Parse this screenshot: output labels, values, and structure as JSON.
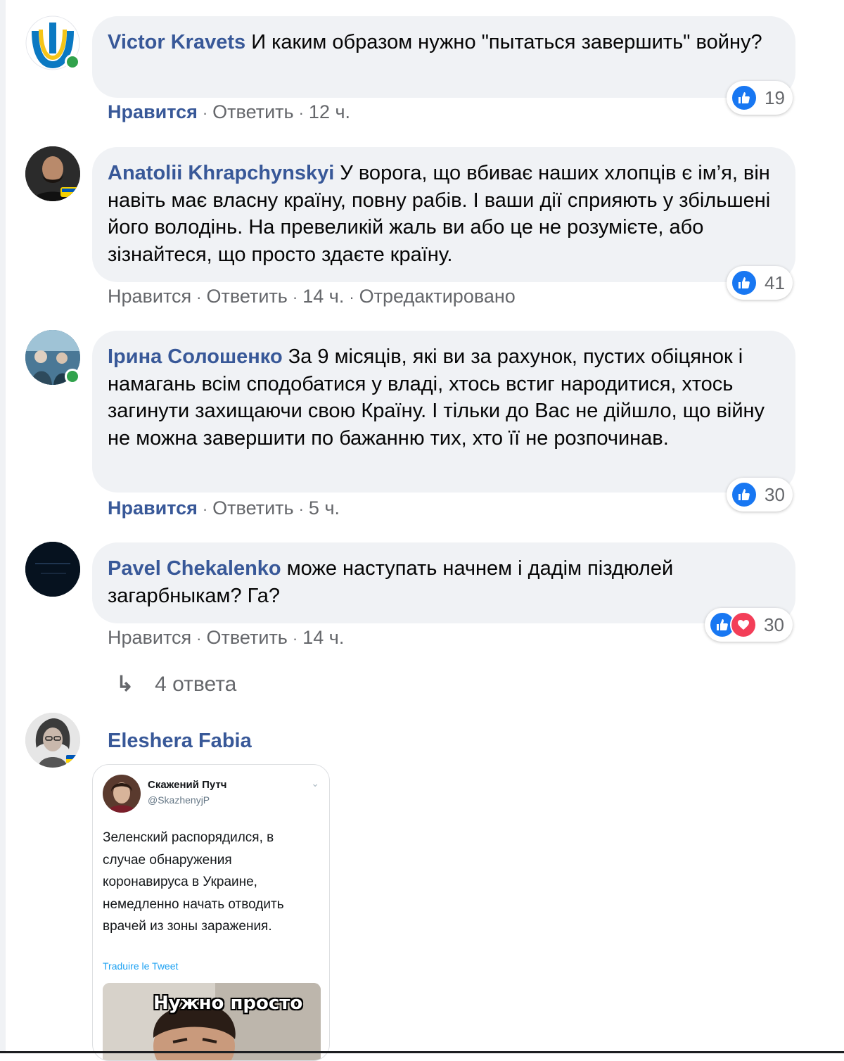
{
  "comments": [
    {
      "author": "Victor Kravets",
      "text": "И каким образом нужно \"пытаться завершить\" войну?",
      "like_label": "Нравится",
      "reply_label": "Ответить",
      "time": "12 ч.",
      "reaction_count": "19",
      "liked": true,
      "online": true
    },
    {
      "author": "Anatolii Khrapchynskyi",
      "text": "У ворога, що вбиває наших хлопців є ім’я, він навіть має власну країну, повну рабів. І ваши дії сприяють у збільшені його володінь. На превеликій жаль ви або це не розумієте, або зізнайтеся, що просто здаєте країну.",
      "like_label": "Нравится",
      "reply_label": "Ответить",
      "time": "14 ч.",
      "edited_label": "Отредактировано",
      "reaction_count": "41",
      "liked": false,
      "online": false
    },
    {
      "author": "Ірина Солошенко",
      "text": "За 9 місяців, які ви за рахунок, пустих обіцянок і намагань всім сподобатися у владі, хтось встиг народитися, хтось загинути захищаючи свою Країну. І тільки до Вас не дійшло, що війну не можна завершити по бажанню тих, хто її не розпочинав.",
      "like_label": "Нравится",
      "reply_label": "Ответить",
      "time": "5 ч.",
      "reaction_count": "30",
      "liked": true,
      "online": true
    },
    {
      "author": "Pavel Chekalenko",
      "text": "може наступать начнем і дадім піздюлей загарбныкам? Га?",
      "like_label": "Нравится",
      "reply_label": "Ответить",
      "time": "14 ч.",
      "reaction_count": "30",
      "liked": false,
      "online": false,
      "replies_label": "4 ответа"
    },
    {
      "author": "Eleshera Fabia"
    }
  ],
  "tweet": {
    "name": "Скажений Путч",
    "handle": "@SkazhenyjP",
    "lines": [
      "Зеленский распорядился, в",
      "случае обнаружения",
      "коронавируса в Украине,",
      "немедленно начать отводить",
      "врачей из зоны заражения."
    ],
    "translate_label": "Traduire le Tweet",
    "meme_caption": "Нужно просто"
  },
  "icons": {
    "like_reaction": "thumbs-up-icon",
    "love_reaction": "heart-icon",
    "reply_arrow": "reply-arrow-icon",
    "tweet_menu": "chevron-down-icon"
  },
  "colors": {
    "author_link": "#385898",
    "bubble_bg": "#f0f2f5",
    "meta_text": "#65676b",
    "like_blue": "#1877f2",
    "love_red": "#f33e58",
    "online_green": "#31a24c"
  }
}
